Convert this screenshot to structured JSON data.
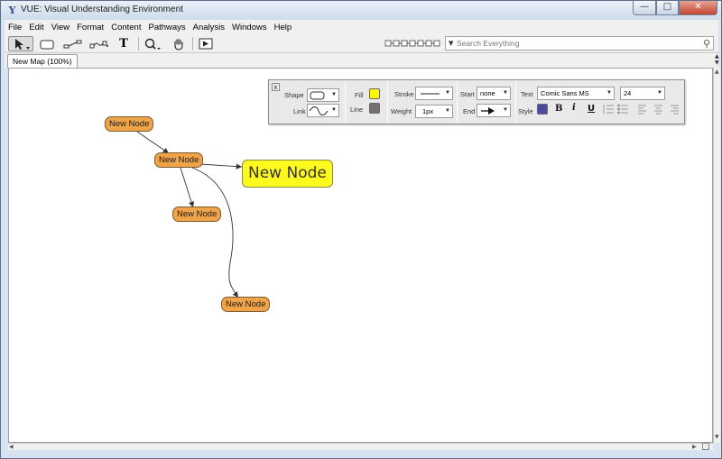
{
  "window": {
    "title": "VUE: Visual Understanding Environment",
    "app_icon": "Y",
    "min_glyph": "—",
    "max_glyph": "□",
    "close_glyph": "✕"
  },
  "menu": [
    "File",
    "Edit",
    "View",
    "Format",
    "Content",
    "Pathways",
    "Analysis",
    "Windows",
    "Help"
  ],
  "toolbar": {
    "tools": [
      "selection-tool",
      "node-tool",
      "link-tool",
      "curved-link-tool",
      "text-tool",
      "zoom-tool",
      "hand-tool",
      "presentation-tool"
    ],
    "text_tool_glyph": "T",
    "search_placeholder": "Search Everything",
    "search_caret": "▼",
    "search_icon": "⚲"
  },
  "tab": {
    "label": "New Map (100%)"
  },
  "map": {
    "nodes": [
      {
        "id": "n1",
        "label": "New Node"
      },
      {
        "id": "n2",
        "label": "New Node"
      },
      {
        "id": "n3",
        "label": "New Node"
      },
      {
        "id": "n4",
        "label": "New Node"
      },
      {
        "id": "n5",
        "label": "New Node"
      }
    ],
    "big_node_color": "#fffa1e",
    "node_color": "#f0a44a"
  },
  "palette": {
    "close": "x",
    "shape_label": "Shape",
    "link_label": "Link",
    "fill_label": "Fill",
    "fill_color": "#ffff00",
    "line_label": "Line",
    "line_color": "#777070",
    "stroke_label": "Stroke",
    "weight_label": "Weight",
    "weight_value": "1px",
    "start_label": "Start",
    "start_value": "none",
    "end_label": "End",
    "text_label": "Text",
    "font_value": "Comic Sans MS",
    "size_value": "24",
    "style_label": "Style",
    "style_color": "#4a4aa0",
    "bold": "B",
    "italic": "i",
    "underline": "U"
  }
}
